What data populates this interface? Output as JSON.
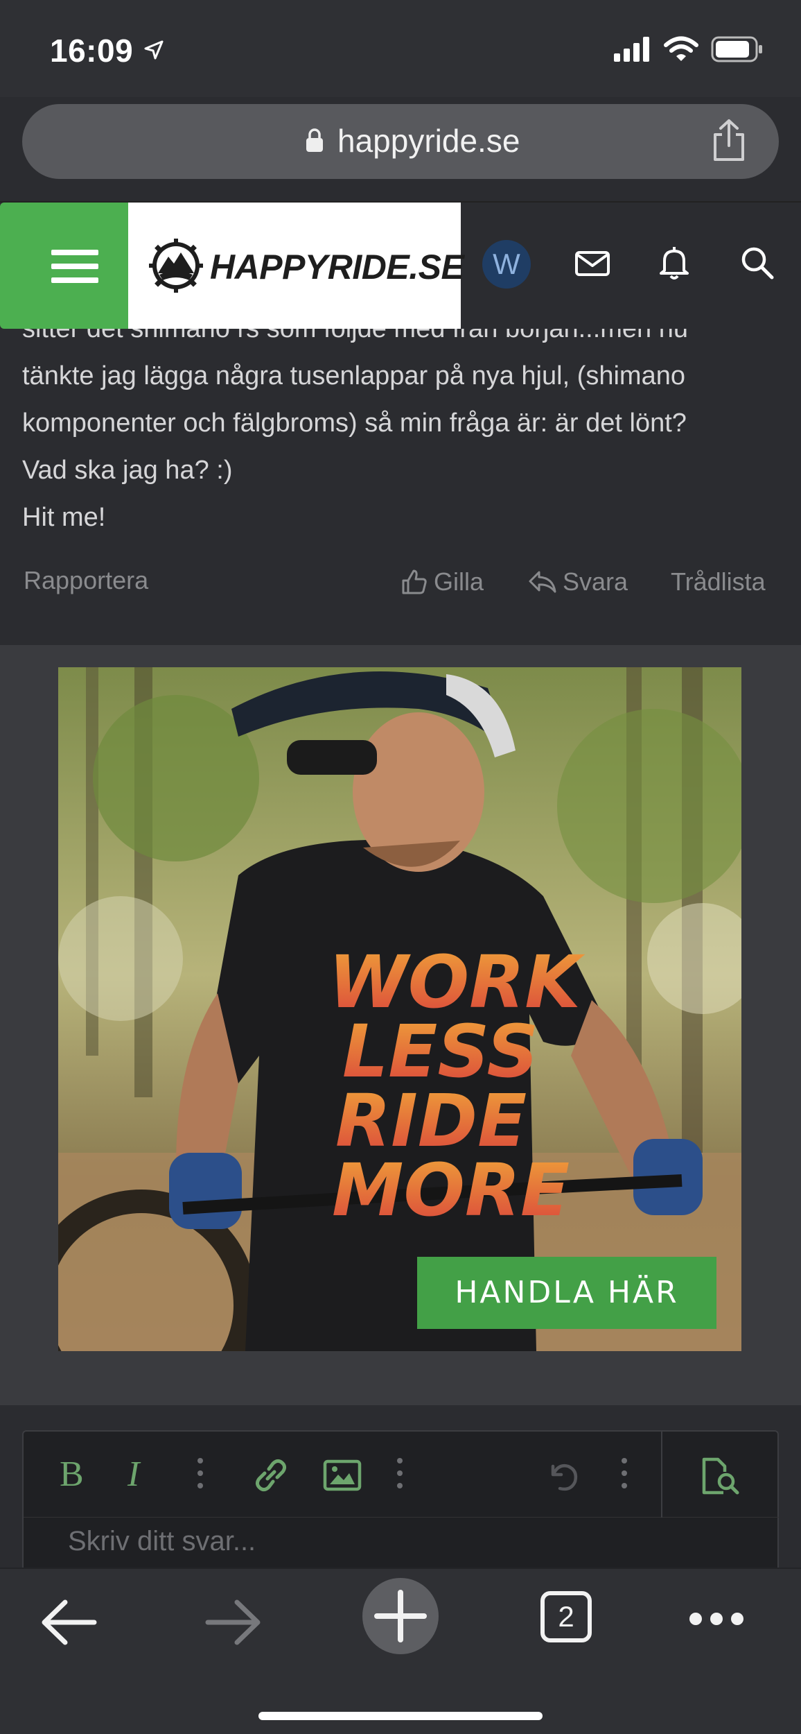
{
  "status_bar": {
    "time": "16:09"
  },
  "browser": {
    "url": "happyride.se"
  },
  "header": {
    "logo_text": "HAPPYRIDE.SE",
    "avatar_letter": "W"
  },
  "post": {
    "lines": [
      "sitter det shimano rs som följde med från början...men nu",
      "tänkte jag lägga några tusenlappar på nya hjul, (shimano",
      "komponenter och fälgbroms) så min fråga är: är det lönt?",
      "Vad ska jag ha? :)",
      "Hit me!"
    ],
    "report_label": "Rapportera",
    "like_label": "Gilla",
    "reply_label": "Svara",
    "thread_list_label": "Trådlista"
  },
  "ad": {
    "shirt_text": [
      "WORK",
      "LESS",
      "RIDE",
      "MORE"
    ],
    "cta_label": "HANDLA HÄR"
  },
  "editor": {
    "placeholder": "Skriv ditt svar...",
    "bold_label": "B",
    "italic_label": "I"
  },
  "bottom_bar": {
    "tab_count": "2"
  }
}
